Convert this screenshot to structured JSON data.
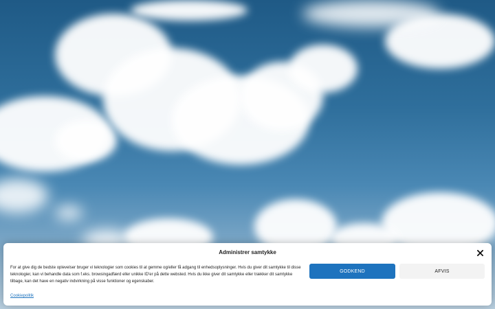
{
  "hero": {
    "image": "sky-with-clouds"
  },
  "consent": {
    "title": "Administrer samtykke",
    "close_icon": "close-icon",
    "message": "For at give dig de bedste oplevelser bruger vi teknologier som cookies til at gemme og/eller få adgang til enhedsoplysninger. Hvis du giver dit samtykke til disse teknologier, kan vi behandle data som f.eks. browsingadfærd eller unikke ID'er på dette websted. Hvis du ikke giver dit samtykke eller trækker dit samtykke tilbage, kan det have en negativ indvirkning på visse funktioner og egenskaber.",
    "accept_label": "GODKEND",
    "deny_label": "AFVIS",
    "policy_link": "Cookiepolitik",
    "accent_color": "#1e73be"
  }
}
